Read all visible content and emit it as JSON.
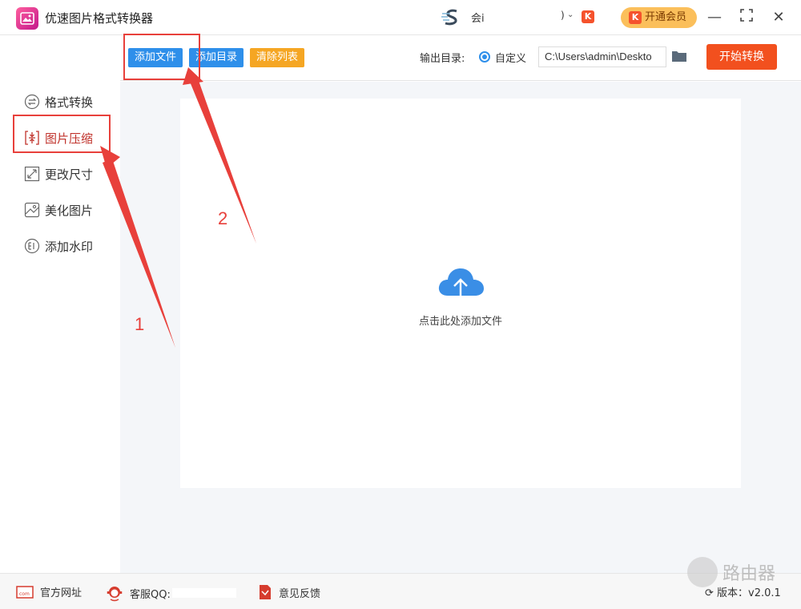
{
  "app": {
    "title": "优速图片格式转换器"
  },
  "titlebar": {
    "user_name": "会",
    "user_tail": "i",
    "close_paren": ")",
    "vip_badge_letter": "K",
    "vip_button_label": "开通会员",
    "minimize": "—",
    "maximize": "⛶",
    "close": "✕"
  },
  "sidebar": {
    "items": [
      {
        "label": "格式转换",
        "icon": "convert-icon",
        "active": false
      },
      {
        "label": "图片压缩",
        "icon": "compress-icon",
        "active": true
      },
      {
        "label": "更改尺寸",
        "icon": "resize-icon",
        "active": false
      },
      {
        "label": "美化图片",
        "icon": "beautify-icon",
        "active": false
      },
      {
        "label": "添加水印",
        "icon": "watermark-icon",
        "active": false
      }
    ]
  },
  "toolbar": {
    "add_file": "添加文件",
    "add_folder": "添加目录",
    "clear_list": "清除列表",
    "output_label": "输出目录:",
    "custom_option": "自定义",
    "output_path": "C:\\Users\\admin\\Deskto",
    "start_button": "开始转换"
  },
  "main": {
    "drop_text": "点击此处添加文件"
  },
  "footer": {
    "website": "官方网址",
    "qq": "客服QQ:",
    "feedback": "意见反馈",
    "version": "版本：v2.0.1"
  },
  "annotations": {
    "step1": "1",
    "step2": "2"
  },
  "watermark": {
    "text": "路由器"
  },
  "colors": {
    "accent_blue": "#2e8fea",
    "accent_orange": "#f5a623",
    "start_red": "#f2501e",
    "vip_gold": "#fbbf5b",
    "active_red": "#c0322b",
    "annotation_red": "#e8403b"
  }
}
